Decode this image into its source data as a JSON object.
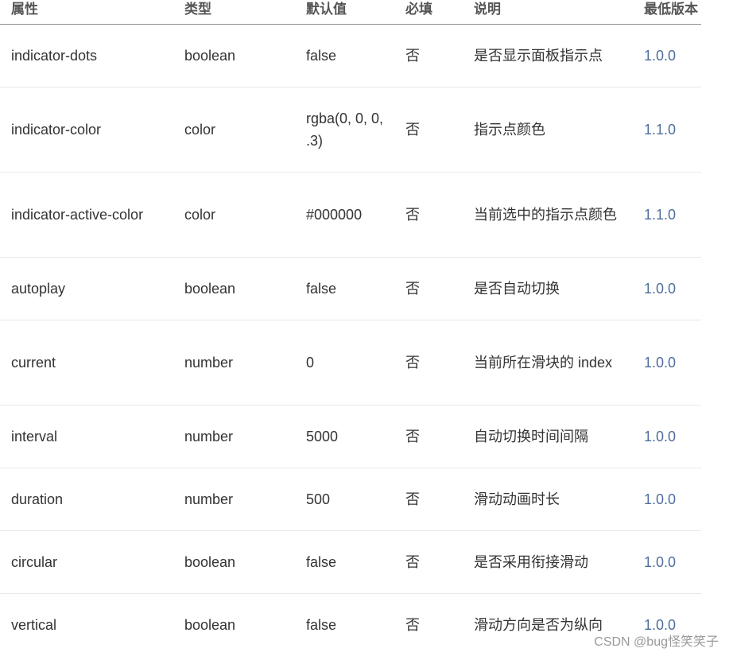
{
  "table": {
    "headers": [
      "属性",
      "类型",
      "默认值",
      "必填",
      "说明",
      "最低版本"
    ],
    "rows": [
      {
        "attr": "indicator-dots",
        "type": "boolean",
        "default": "false",
        "required": "否",
        "desc": "是否显示面板指示点",
        "version": "1.0.0"
      },
      {
        "attr": "indicator-color",
        "type": "color",
        "default": "rgba(0, 0, 0, .3)",
        "required": "否",
        "desc": "指示点颜色",
        "version": "1.1.0"
      },
      {
        "attr": "indicator-active-color",
        "type": "color",
        "default": "#000000",
        "required": "否",
        "desc": "当前选中的指示点颜色",
        "version": "1.1.0"
      },
      {
        "attr": "autoplay",
        "type": "boolean",
        "default": "false",
        "required": "否",
        "desc": "是否自动切换",
        "version": "1.0.0"
      },
      {
        "attr": "current",
        "type": "number",
        "default": "0",
        "required": "否",
        "desc": "当前所在滑块的 index",
        "version": "1.0.0"
      },
      {
        "attr": "interval",
        "type": "number",
        "default": "5000",
        "required": "否",
        "desc": "自动切换时间间隔",
        "version": "1.0.0"
      },
      {
        "attr": "duration",
        "type": "number",
        "default": "500",
        "required": "否",
        "desc": "滑动动画时长",
        "version": "1.0.0"
      },
      {
        "attr": "circular",
        "type": "boolean",
        "default": "false",
        "required": "否",
        "desc": "是否采用衔接滑动",
        "version": "1.0.0"
      },
      {
        "attr": "vertical",
        "type": "boolean",
        "default": "false",
        "required": "否",
        "desc": "滑动方向是否为纵向",
        "version": "1.0.0"
      }
    ]
  },
  "watermark": "CSDN @bug怪笑笑子",
  "colors": {
    "version_link": "#4e6e9e",
    "row_border": "#e8e8e8",
    "header_border": "#8f8f8f"
  }
}
